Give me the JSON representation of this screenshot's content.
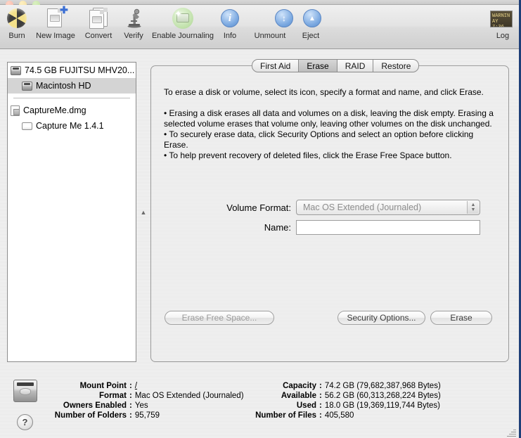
{
  "toolbar": {
    "items": [
      {
        "label": "Burn",
        "icon": "burn-icon"
      },
      {
        "label": "New Image",
        "icon": "new-image-icon"
      },
      {
        "label": "Convert",
        "icon": "convert-icon"
      },
      {
        "label": "Verify",
        "icon": "verify-microscope-icon"
      },
      {
        "label": "Enable Journaling",
        "icon": "enable-journaling-icon"
      },
      {
        "label": "Info",
        "icon": "info-icon"
      },
      {
        "label": "Unmount",
        "icon": "unmount-icon"
      },
      {
        "label": "Eject",
        "icon": "eject-icon"
      }
    ],
    "log": {
      "label": "Log",
      "icon": "log-icon",
      "thumb_line1": "WARNIN",
      "thumb_line2": "AY 7:36 "
    },
    "info_glyph": "i",
    "unmount_glyph": "↕",
    "eject_glyph": "▲",
    "journal_spark": "✦"
  },
  "sidebar": {
    "items": [
      {
        "label": "74.5 GB FUJITSU MHV20...",
        "icon": "hard-disk-icon",
        "indent": false,
        "selected": false
      },
      {
        "label": "Macintosh HD",
        "icon": "hard-disk-icon",
        "indent": true,
        "selected": true
      },
      {
        "label": "CaptureMe.dmg",
        "icon": "disk-image-icon",
        "indent": false,
        "selected": false
      },
      {
        "label": "Capture Me 1.4.1",
        "icon": "volume-icon",
        "indent": true,
        "selected": false
      }
    ]
  },
  "tabs": [
    {
      "label": "First Aid",
      "active": false
    },
    {
      "label": "Erase",
      "active": true
    },
    {
      "label": "RAID",
      "active": false
    },
    {
      "label": "Restore",
      "active": false
    }
  ],
  "erase_panel": {
    "intro": "To erase a disk or volume, select its icon, specify a format and name, and click Erase.",
    "bullets": [
      "• Erasing a disk erases all data and volumes on a disk, leaving the disk empty. Erasing a selected volume erases that volume only, leaving other volumes on the disk unchanged.",
      "• To securely erase data, click Security Options and select an option before clicking Erase.",
      "• To help prevent recovery of deleted files, click the Erase Free Space button."
    ],
    "volume_format_label": "Volume Format:",
    "volume_format_value": "Mac OS Extended (Journaled)",
    "name_label": "Name:",
    "name_value": "",
    "name_placeholder": "",
    "erase_free_space_button": "Erase Free Space...",
    "security_options_button": "Security Options...",
    "erase_button": "Erase"
  },
  "info": {
    "left": [
      {
        "key": "Mount Point",
        "value": "/",
        "link": true
      },
      {
        "key": "Format",
        "value": "Mac OS Extended (Journaled)",
        "link": false
      },
      {
        "key": "Owners Enabled",
        "value": "Yes",
        "link": false
      },
      {
        "key": "Number of Folders",
        "value": "95,759",
        "link": false
      }
    ],
    "right": [
      {
        "key": "Capacity",
        "value": "74.2 GB (79,682,387,968 Bytes)"
      },
      {
        "key": "Available",
        "value": "56.2 GB (60,313,268,224 Bytes)"
      },
      {
        "key": "Used",
        "value": "18.0 GB (19,369,119,744 Bytes)"
      },
      {
        "key": "Number of Files",
        "value": "405,580"
      }
    ],
    "disk_icon": "hard-disk-icon",
    "help_button": "?"
  },
  "colors": {
    "window_bg": "#eeeeee",
    "selection": "#d4d4d4",
    "border": "#1e3f78",
    "accent_blue": "#7aa8e0"
  }
}
